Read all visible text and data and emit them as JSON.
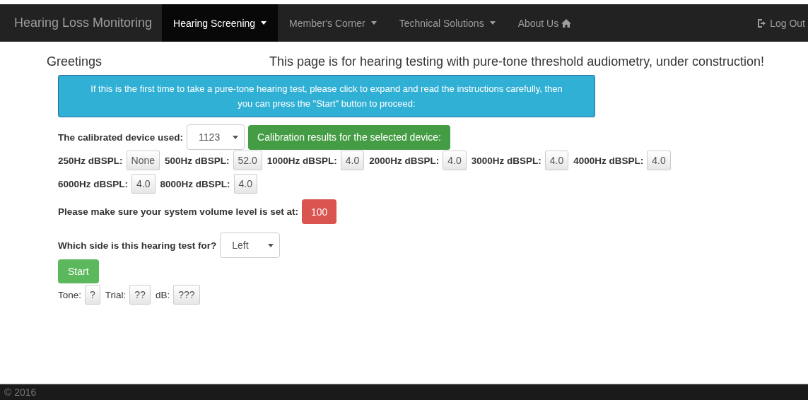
{
  "navbar": {
    "brand": "Hearing Loss Monitoring",
    "items": [
      {
        "label": "Hearing Screening",
        "selected": true,
        "kind": "dropdown"
      },
      {
        "label": "Member's Corner",
        "selected": false,
        "kind": "dropdown"
      },
      {
        "label": "Technical Solutions",
        "selected": false,
        "kind": "dropdown"
      },
      {
        "label": "About Us",
        "selected": false,
        "kind": "home"
      }
    ],
    "logout": "Log Out"
  },
  "greeting": "Greetings",
  "notice": "This page is for hearing testing with pure-tone threshold audiometry, under construction!",
  "instructions": "If this is the first time to take a pure-tone hearing test, please click to expand and read the instructions carefully, then you can press the \"Start\" button to proceed:",
  "device": {
    "label": "The calibrated device used:",
    "value": "1123",
    "results_button": "Calibration results for the selected device:"
  },
  "calibration": [
    {
      "label": "250Hz dBSPL:",
      "value": "None"
    },
    {
      "label": "500Hz dBSPL:",
      "value": "52.0"
    },
    {
      "label": "1000Hz dBSPL:",
      "value": "4.0"
    },
    {
      "label": "2000Hz dBSPL:",
      "value": "4.0"
    },
    {
      "label": "3000Hz dBSPL:",
      "value": "4.0"
    },
    {
      "label": "4000Hz dBSPL:",
      "value": "4.0"
    },
    {
      "label": "6000Hz dBSPL:",
      "value": "4.0"
    },
    {
      "label": "8000Hz dBSPL:",
      "value": "4.0"
    }
  ],
  "volume": {
    "label": "Please make sure your system volume level is set at:",
    "value": "100"
  },
  "side": {
    "label": "Which side is this hearing test for?",
    "value": "Left"
  },
  "start_button": "Start",
  "status": [
    {
      "label": "Tone:",
      "value": "?"
    },
    {
      "label": "Trial:",
      "value": "??"
    },
    {
      "label": "dB:",
      "value": "???"
    }
  ],
  "footer": "© 2016"
}
